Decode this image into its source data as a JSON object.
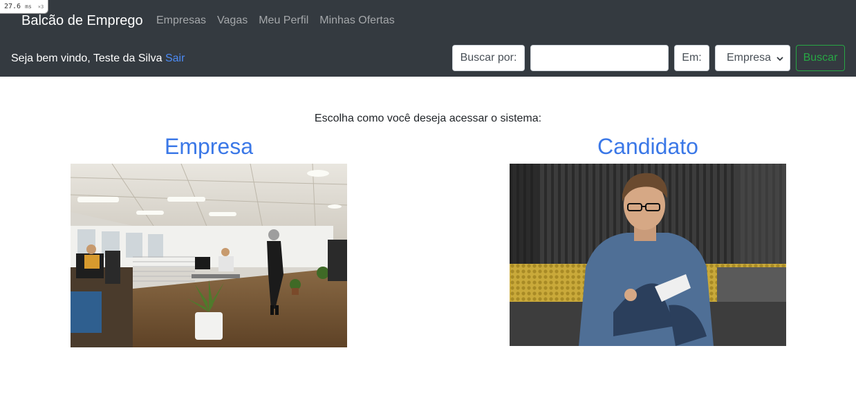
{
  "perf": {
    "value": "27.6",
    "unit": "ms",
    "multiplier": "×3"
  },
  "navbar": {
    "brand": "Balcão de Emprego",
    "links": [
      "Empresas",
      "Vagas",
      "Meu Perfil",
      "Minhas Ofertas"
    ],
    "welcome_text": "Seja bem vindo, Teste da Silva",
    "logout_label": "Sair",
    "colors": {
      "background": "#343a40",
      "link_accent": "#4c8bf5",
      "search_button": "#28a745"
    }
  },
  "search": {
    "by_label": "Buscar por:",
    "query_value": "",
    "in_label": "Em:",
    "scope_selected": "Empresa",
    "submit_label": "Buscar"
  },
  "main": {
    "prompt": "Escolha como você deseja acessar o sistema:",
    "options": [
      {
        "title": "Empresa",
        "image": "office-photo"
      },
      {
        "title": "Candidato",
        "image": "candidate-photo"
      }
    ],
    "title_color": "#3b78e7"
  }
}
